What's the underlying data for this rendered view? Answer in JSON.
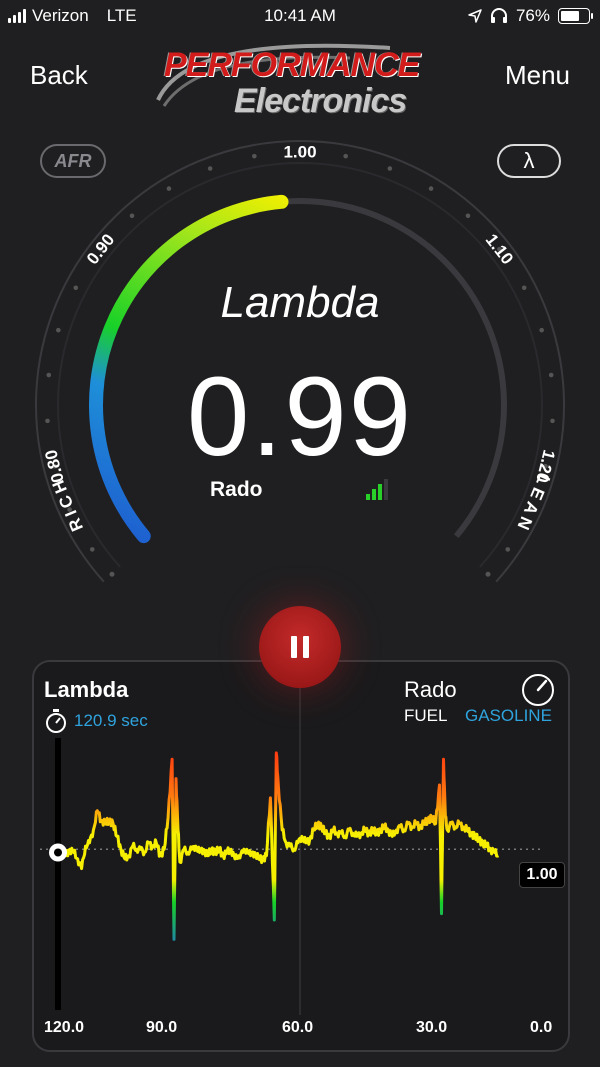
{
  "status_bar": {
    "carrier": "Verizon",
    "network": "LTE",
    "time": "10:41 AM",
    "battery": "76%",
    "battery_level": 0.76
  },
  "nav": {
    "back_label": "Back",
    "menu_label": "Menu"
  },
  "logo": {
    "line1": "PERFORMANCE",
    "line2": "Electronics"
  },
  "gauge": {
    "afr_label": "AFR",
    "lambda_symbol": "λ",
    "title": "Lambda",
    "value": "0.99",
    "value_numeric": 0.99,
    "sensor": "Rado",
    "scale_min": 0.75,
    "scale_max": 1.25,
    "tick_labels": [
      "0.80",
      "0.90",
      "1.00",
      "1.10",
      "1.20"
    ],
    "rich_label": "RICH",
    "lean_label": "LEAN",
    "signal_bars_active": 3,
    "colors": {
      "blue": "#1e6fd0",
      "green": "#18d128",
      "yellow": "#f4f000",
      "track": "#3a3a3e"
    }
  },
  "graph": {
    "title": "Lambda",
    "duration": "120.9 sec",
    "sensor": "Rado",
    "fuel_label": "FUEL",
    "fuel_type": "GASOLINE",
    "current_value": "1.00",
    "x_ticks": [
      "120.0",
      "90.0",
      "60.0",
      "30.0",
      "0.0"
    ],
    "y_ref": 1.0,
    "y_min": 0.82,
    "y_max": 1.17,
    "accent_color": "#2fa3dd",
    "series": [
      [
        120.0,
        0.995
      ],
      [
        119,
        1.0
      ],
      [
        118,
        0.99
      ],
      [
        117,
        1.0
      ],
      [
        116,
        0.995
      ],
      [
        115,
        0.985
      ],
      [
        114,
        0.97
      ],
      [
        113,
        1.005
      ],
      [
        112,
        1.01
      ],
      [
        111,
        1.03
      ],
      [
        110,
        1.06
      ],
      [
        109,
        1.045
      ],
      [
        108,
        1.04
      ],
      [
        107,
        1.045
      ],
      [
        106,
        1.04
      ],
      [
        105,
        1.02
      ],
      [
        104,
        1.0
      ],
      [
        103,
        0.985
      ],
      [
        102,
        0.99
      ],
      [
        101,
        1.005
      ],
      [
        100,
        1.0
      ],
      [
        99,
        1.0
      ],
      [
        98,
        0.995
      ],
      [
        97,
        1.01
      ],
      [
        96,
        1.005
      ],
      [
        95,
        1.01
      ],
      [
        94,
        0.99
      ],
      [
        93,
        1.0
      ],
      [
        92,
        1.05
      ],
      [
        91,
        1.14
      ],
      [
        90.5,
        0.86
      ],
      [
        90,
        1.11
      ],
      [
        89.5,
        1.03
      ],
      [
        89,
        0.98
      ],
      [
        88,
        1.0
      ],
      [
        87,
        0.995
      ],
      [
        86,
        1.0
      ],
      [
        85,
        1.005
      ],
      [
        84,
        0.995
      ],
      [
        83,
        1.0
      ],
      [
        82,
        0.99
      ],
      [
        81,
        1.0
      ],
      [
        80,
        0.995
      ],
      [
        79,
        1.0
      ],
      [
        78,
        0.99
      ],
      [
        77,
        0.995
      ],
      [
        76,
        1.0
      ],
      [
        75,
        0.985
      ],
      [
        74,
        0.99
      ],
      [
        73,
        0.995
      ],
      [
        72,
        1.0
      ],
      [
        71,
        0.99
      ],
      [
        70,
        0.995
      ],
      [
        69,
        0.985
      ],
      [
        68,
        0.985
      ],
      [
        67,
        0.99
      ],
      [
        66,
        1.08
      ],
      [
        65,
        0.89
      ],
      [
        64.5,
        1.15
      ],
      [
        64,
        1.1
      ],
      [
        63,
        1.03
      ],
      [
        62,
        1.01
      ],
      [
        61,
        1.005
      ],
      [
        60,
        1.0
      ],
      [
        59,
        1.01
      ],
      [
        58,
        1.02
      ],
      [
        57,
        1.01
      ],
      [
        56,
        1.015
      ],
      [
        55,
        1.03
      ],
      [
        54,
        1.04
      ],
      [
        53,
        1.035
      ],
      [
        52,
        1.025
      ],
      [
        51,
        1.02
      ],
      [
        50,
        1.03
      ],
      [
        49,
        1.025
      ],
      [
        48,
        1.025
      ],
      [
        47,
        1.02
      ],
      [
        46,
        1.03
      ],
      [
        45,
        1.025
      ],
      [
        44,
        1.02
      ],
      [
        43,
        1.025
      ],
      [
        42,
        1.03
      ],
      [
        41,
        1.025
      ],
      [
        40,
        1.03
      ],
      [
        39,
        1.025
      ],
      [
        38,
        1.03
      ],
      [
        37,
        1.035
      ],
      [
        36,
        1.03
      ],
      [
        35,
        1.02
      ],
      [
        34,
        1.03
      ],
      [
        33,
        1.035
      ],
      [
        32,
        1.03
      ],
      [
        31,
        1.04
      ],
      [
        30,
        1.035
      ],
      [
        29,
        1.04
      ],
      [
        28,
        1.035
      ],
      [
        27,
        1.04
      ],
      [
        26,
        1.045
      ],
      [
        25,
        1.05
      ],
      [
        24,
        1.04
      ],
      [
        23,
        1.1
      ],
      [
        22.5,
        0.9
      ],
      [
        22,
        1.14
      ],
      [
        21.5,
        1.05
      ],
      [
        21,
        1.03
      ],
      [
        20,
        1.04
      ],
      [
        19,
        1.035
      ],
      [
        18,
        1.04
      ],
      [
        17,
        1.035
      ],
      [
        16,
        1.03
      ],
      [
        15,
        1.025
      ],
      [
        14,
        1.02
      ],
      [
        13,
        1.015
      ],
      [
        12,
        1.01
      ],
      [
        11,
        1.005
      ],
      [
        10,
        1.0
      ],
      [
        9,
        0.995
      ],
      [
        8,
        0.99
      ]
    ]
  }
}
